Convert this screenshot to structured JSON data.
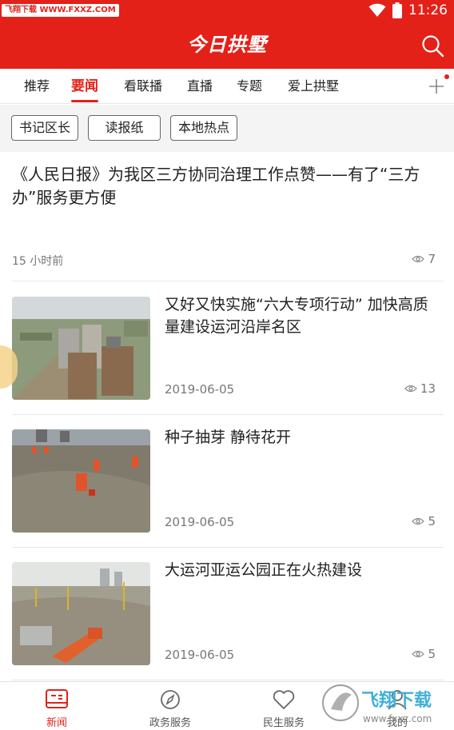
{
  "status": {
    "watermark": "飞翔下载 WWW.FXXZ.COM",
    "time": "11:26"
  },
  "header": {
    "title": "今日拱墅"
  },
  "tabs": [
    "推荐",
    "要闻",
    "看联播",
    "直播",
    "专题",
    "爱上拱墅"
  ],
  "active_tab": 1,
  "chips": [
    "书记区长",
    "读报纸",
    "本地热点"
  ],
  "top_article": {
    "title": "《人民日报》为我区三方协同治理工作点赞——有了“三方办”服务更方便",
    "time": "15 小时前",
    "views": "7"
  },
  "articles": [
    {
      "title": "又好又快实施“六大专项行动” 加快高质量建设运河沿岸名区",
      "date": "2019-06-05",
      "views": "13"
    },
    {
      "title": "种子抽芽 静待花开",
      "date": "2019-06-05",
      "views": "5"
    },
    {
      "title": "大运河亚运公园正在火热建设",
      "date": "2019-06-05",
      "views": "5"
    }
  ],
  "bottom_nav": [
    "新闻",
    "政务服务",
    "民生服务",
    "我的"
  ],
  "bottom_watermark": {
    "brand": "飞翔下载",
    "url": "www.fxxz.com"
  },
  "colors": {
    "brand_red": "#e32119",
    "text": "#222222",
    "muted": "#777777"
  }
}
